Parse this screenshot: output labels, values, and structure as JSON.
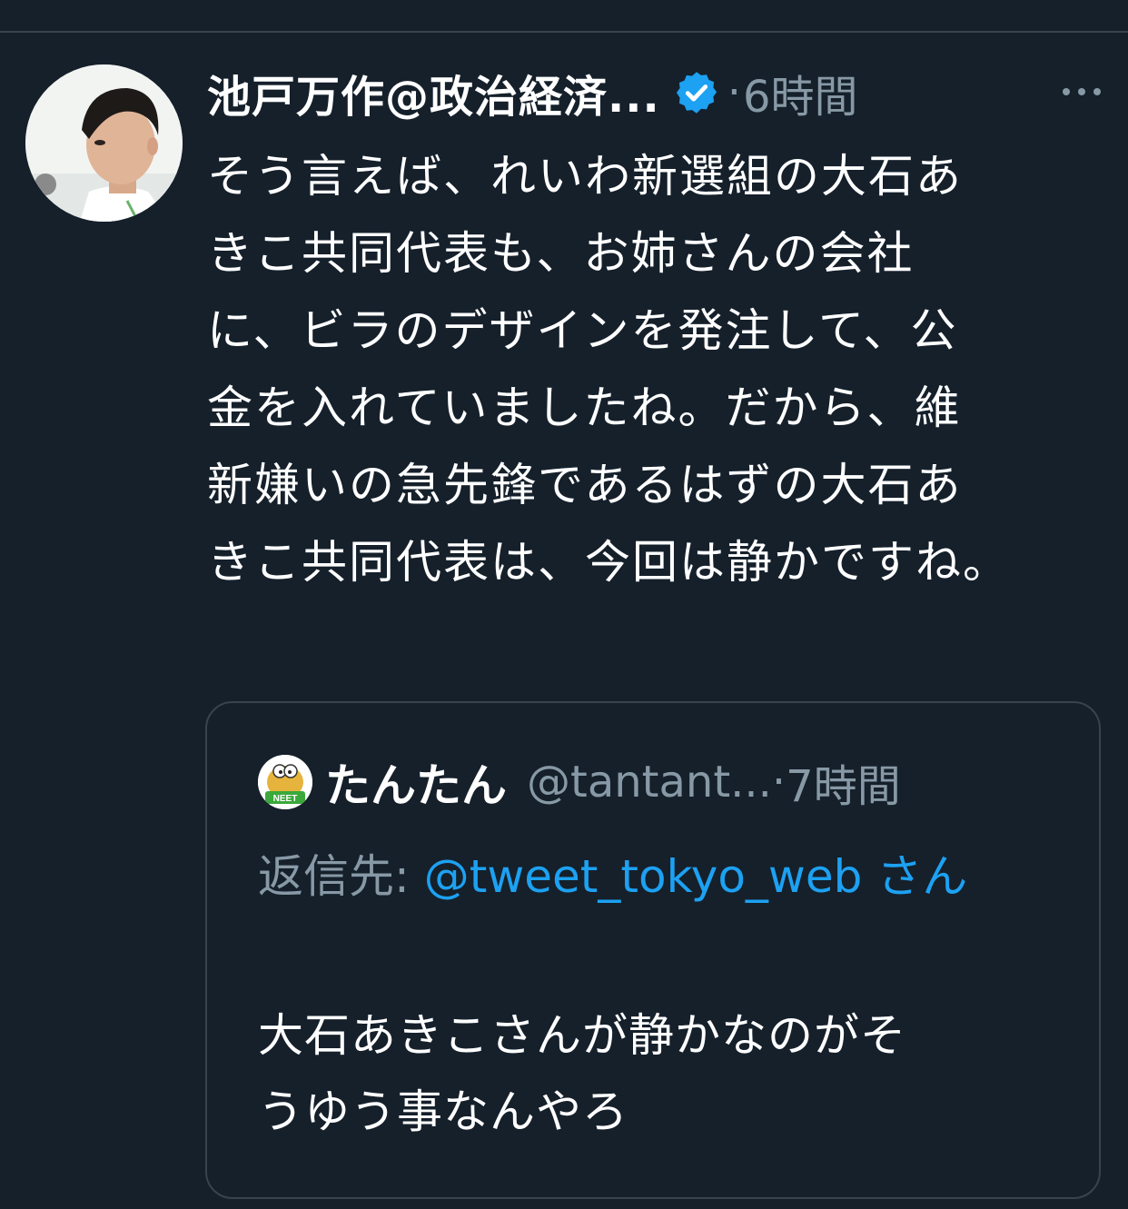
{
  "tweet": {
    "author_name": "池戸万作@政治経済...",
    "dot": "·",
    "time": "6時間",
    "text": "そう言えば、れいわ新選組の大石あ\nきこ共同代表も、お姉さんの会社\nに、ビラのデザインを発注して、公\n金を入れていましたね。だから、維\n新嫌いの急先鋒であるはずの大石あ\nきこ共同代表は、今回は静かですね。"
  },
  "quote": {
    "author_name": "たんたん",
    "handle": "@tantant...",
    "dot": "·",
    "time": "7時間",
    "reply_prefix": "返信先: ",
    "reply_mention": "@tweet_tokyo_web",
    "reply_suffix": " さん",
    "text": "大石あきこさんが静かなのがそ\nうゆう事なんやろ",
    "avatar_label": "NEET"
  },
  "colors": {
    "background": "#15202b",
    "divider": "#38444d",
    "text_primary": "#ffffff",
    "text_secondary": "#8899a6",
    "accent": "#1da1f2"
  }
}
